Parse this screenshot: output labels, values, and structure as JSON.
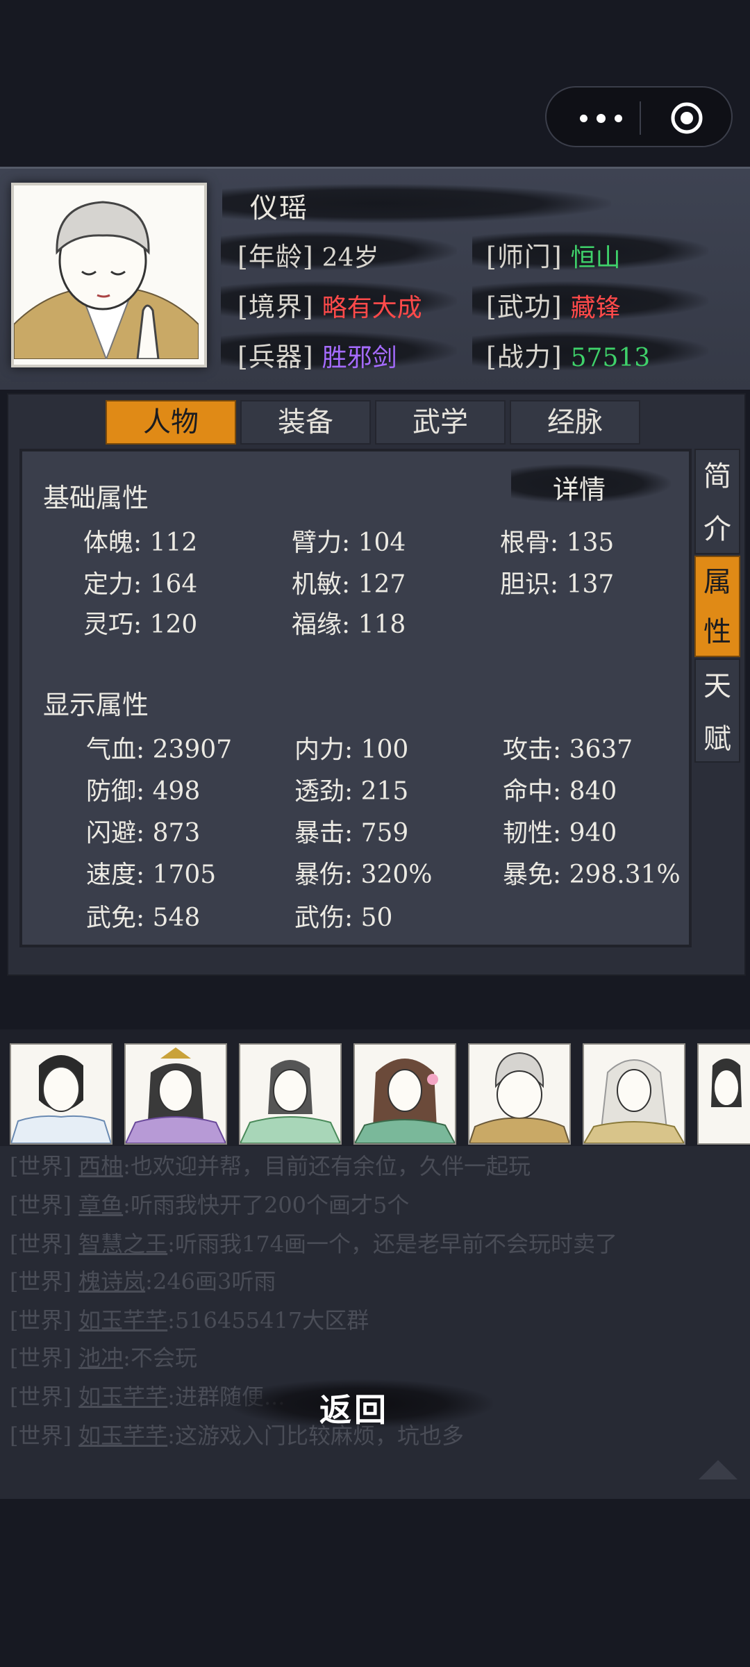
{
  "colors": {
    "accent": "#e08a16",
    "green": "#3fd16a",
    "red": "#ff4a4a",
    "purple": "#a56bff"
  },
  "profile": {
    "name": "仪瑶",
    "age_label": "[年龄]",
    "age": "24岁",
    "sect_label": "[师门]",
    "sect": "恒山",
    "realm_label": "[境界]",
    "realm": "略有大成",
    "skill_label": "[武功]",
    "skill": "藏锋",
    "weapon_label": "[兵器]",
    "weapon": "胜邪剑",
    "power_label": "[战力]",
    "power": "57513"
  },
  "tabs": [
    "人物",
    "装备",
    "武学",
    "经脉"
  ],
  "side_tabs": [
    [
      "简",
      "介"
    ],
    [
      "属",
      "性"
    ],
    [
      "天",
      "赋"
    ]
  ],
  "detail": "详情",
  "basic": {
    "title": "基础属性",
    "stats": [
      "体魄: 112",
      "臂力: 104",
      "根骨: 135",
      "定力: 164",
      "机敏: 127",
      "胆识: 137",
      "灵巧: 120",
      "福缘: 118"
    ]
  },
  "display": {
    "title": "显示属性",
    "stats": [
      "气血: 23907",
      "内力: 100",
      "攻击: 3637",
      "防御: 498",
      "透劲: 215",
      "命中: 840",
      "闪避: 873",
      "暴击: 759",
      "韧性: 940",
      "速度: 1705",
      "暴伤: 320%",
      "暴免: 298.31%",
      "武免: 548",
      "武伤: 50"
    ]
  },
  "chat": [
    {
      "ch": "[世界]",
      "name": "西柚",
      "msg": ":也欢迎并帮，目前还有余位，久伴一起玩"
    },
    {
      "ch": "[世界]",
      "name": "章鱼",
      "msg": ":听雨我快开了200个画才5个"
    },
    {
      "ch": "[世界]",
      "name": "智慧之王",
      "msg": ":听雨我174画一个，还是老早前不会玩时卖了"
    },
    {
      "ch": "[世界]",
      "name": "槐诗岚",
      "msg": ":246画3听雨"
    },
    {
      "ch": "[世界]",
      "name": "如玉芊芊",
      "msg": ":516455417大区群"
    },
    {
      "ch": "[世界]",
      "name": "池冲",
      "msg": ":不会玩"
    },
    {
      "ch": "[世界]",
      "name": "如玉芊芊",
      "msg": ":进群随便..."
    },
    {
      "ch": "[世界]",
      "name": "如玉芊芊",
      "msg": ":这游戏入门比较麻烦，坑也多"
    }
  ],
  "back_label": "返回"
}
